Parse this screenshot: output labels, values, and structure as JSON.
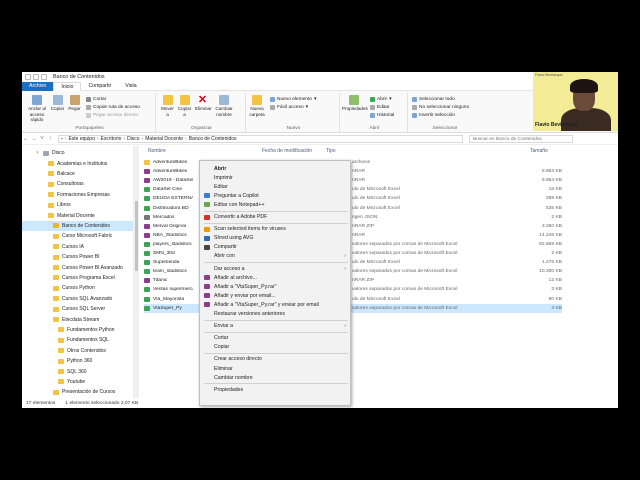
{
  "window": {
    "title": "Banco de Contenidos",
    "tabs": [
      "Archivo",
      "Inicio",
      "Compartir",
      "Vista"
    ]
  },
  "ribbon": {
    "portapapeles": {
      "label": "Portapapeles",
      "anclar": "Anclar al acceso rápido",
      "copiar": "Copiar",
      "pegar": "Pegar",
      "cortar": "Cortar",
      "copiar_ruta": "Copiar ruta de acceso",
      "pegar_acceso": "Pegar acceso directo"
    },
    "organizar": {
      "label": "Organizar",
      "mover": "Mover a",
      "copiar": "Copiar a",
      "eliminar": "Eliminar",
      "cambiar": "Cambiar nombre"
    },
    "nuevo": {
      "label": "Nuevo",
      "nueva_carpeta": "Nueva carpeta",
      "nuevo_elemento": "Nuevo elemento",
      "facil_acceso": "Fácil acceso"
    },
    "abrir": {
      "label": "Abrir",
      "propiedades": "Propiedades",
      "abrir": "Abrir",
      "editar": "Editar",
      "historial": "Historial"
    },
    "seleccionar": {
      "label": "Seleccionar",
      "todo": "Seleccionar todo",
      "ninguno": "No seleccionar ninguno",
      "invertir": "Invertir selección"
    }
  },
  "address": {
    "crumbs": [
      "Este equipo",
      "Escritorio",
      "Disco",
      "Material Docente",
      "Banco de Contenidos"
    ],
    "search_placeholder": "Buscar en Banco de Contenidos"
  },
  "columns": {
    "name": "Nombre",
    "date": "Fecha de modificación",
    "type": "Tipo",
    "size": "Tamaño"
  },
  "nav": [
    {
      "label": "Disco",
      "indent": 0
    },
    {
      "label": "Academias e Institutos",
      "indent": 1
    },
    {
      "label": "Balcace",
      "indent": 1
    },
    {
      "label": "Consultoras",
      "indent": 1
    },
    {
      "label": "Formaciones Empresas",
      "indent": 1
    },
    {
      "label": "Libros",
      "indent": 1
    },
    {
      "label": "Material Docente",
      "indent": 1
    },
    {
      "label": "Banco de Contenidos",
      "indent": 2,
      "selected": true
    },
    {
      "label": "Curso Microsoft Fabric",
      "indent": 2
    },
    {
      "label": "Cursos IA",
      "indent": 2
    },
    {
      "label": "Cursos Power BI",
      "indent": 2
    },
    {
      "label": "Cursos Power BI Avanzado",
      "indent": 2
    },
    {
      "label": "Cursos Programa Excel",
      "indent": 2
    },
    {
      "label": "Cursos Python",
      "indent": 2
    },
    {
      "label": "Cursos SQL Avanzado",
      "indent": 2
    },
    {
      "label": "Cursos SQL Server",
      "indent": 2
    },
    {
      "label": "Etecdata Stream",
      "indent": 2
    },
    {
      "label": "Fundamentos Python",
      "indent": 3
    },
    {
      "label": "Fundamentos SQL",
      "indent": 3
    },
    {
      "label": "Otros Contenidos",
      "indent": 3
    },
    {
      "label": "Python 360",
      "indent": 3
    },
    {
      "label": "SQL 360",
      "indent": 3
    },
    {
      "label": "Youtube",
      "indent": 3
    },
    {
      "label": "Presentación de Cursos",
      "indent": 2
    }
  ],
  "files": [
    {
      "name": "AdventureBikes",
      "type": "archivos",
      "size": ""
    },
    {
      "name": "AdventureBikes",
      "type": "nRAR",
      "size": "9.853 KB"
    },
    {
      "name": "AW2019 - DataSet",
      "type": "nRAR",
      "size": "9.854 KB"
    },
    {
      "name": "DataSet Cine",
      "type": "ulo de Microsoft Excel",
      "size": "18 KB"
    },
    {
      "name": "DEUDA EXTERNA",
      "type": "ulo de Microsoft Excel",
      "size": "289 KB"
    },
    {
      "name": "Distribuidora BD",
      "type": "ulo de Microsoft Excel",
      "size": "535 KB"
    },
    {
      "name": "Mercados",
      "type": "rigen JSON",
      "size": "2 KB"
    },
    {
      "name": "Merval Original",
      "type": "nRAR ZIP",
      "size": "3.250 KB"
    },
    {
      "name": "NBA_Stadistics",
      "type": "nRAR",
      "size": "14.246 KB"
    },
    {
      "name": "players_stadistics",
      "type": "valores separados por comas de Microsoft Excel",
      "size": "82.669 KB"
    },
    {
      "name": "SMN_30d",
      "type": "valores separados por comas de Microsoft Excel",
      "size": "2 KB"
    },
    {
      "name": "Supertienda",
      "type": "ulo de Microsoft Excel",
      "size": "1.276 KB"
    },
    {
      "name": "team_stadistics",
      "type": "valores separados por comas de Microsoft Excel",
      "size": "10.300 KB"
    },
    {
      "name": "Titanic",
      "type": "nRAR ZIP",
      "size": "12 KB"
    },
    {
      "name": "Ventas supermercado",
      "type": "valores separados por comas de Microsoft Excel",
      "size": "3 KB"
    },
    {
      "name": "Vta_Mayorista",
      "type": "ulo de Microsoft Excel",
      "size": "80 KB"
    },
    {
      "name": "VtaSuper_Py",
      "type": "valores separados por comas de Microsoft Excel",
      "size": "3 KB",
      "selected": true
    }
  ],
  "context_menu": [
    {
      "label": "Abrir",
      "bold": true
    },
    {
      "label": "Imprimir"
    },
    {
      "label": "Editar"
    },
    {
      "label": "Preguntar a Copilot",
      "icon": "#3b7bd4"
    },
    {
      "label": "Editar con Notepad++",
      "icon": "#6aa84f"
    },
    {
      "sep": true
    },
    {
      "label": "Convertir a Adobe PDF",
      "icon": "#d93025"
    },
    {
      "sep": true
    },
    {
      "label": "Scan selected items for viruses",
      "icon": "#f29900"
    },
    {
      "label": "Shred using AVG",
      "icon": "#2c6bb5"
    },
    {
      "label": "Compartir",
      "icon": "#444444"
    },
    {
      "label": "Abrir con",
      "submenu": true
    },
    {
      "sep": true
    },
    {
      "label": "Dar acceso a",
      "submenu": true
    },
    {
      "label": "Añadir al archivo...",
      "icon": "#8e3b8e"
    },
    {
      "label": "Añadir a \"VtaSuper_Py.rar\"",
      "icon": "#8e3b8e"
    },
    {
      "label": "Añadir y enviar por email...",
      "icon": "#8e3b8e"
    },
    {
      "label": "Añadir a \"VtaSuper_Py.rar\" y enviar por email",
      "icon": "#8e3b8e"
    },
    {
      "label": "Restaurar versiones anteriores"
    },
    {
      "sep": true
    },
    {
      "label": "Enviar a",
      "submenu": true
    },
    {
      "sep": true
    },
    {
      "label": "Cortar"
    },
    {
      "label": "Copiar"
    },
    {
      "sep": true
    },
    {
      "label": "Crear acceso directo"
    },
    {
      "label": "Eliminar"
    },
    {
      "label": "Cambiar nombre"
    },
    {
      "sep": true
    },
    {
      "label": "Propiedades"
    }
  ],
  "status": {
    "count": "17 elementos",
    "selection": "1 elemento seleccionado  2,07 KB"
  },
  "webcam": {
    "name": "Flavio Bevilacqua",
    "caption": "Flavio Bevilacqua"
  },
  "colors": {
    "file_tab": "#1b6ec2",
    "selection": "#cce8ff",
    "folder": "#f3c342",
    "webcam_bg": "#f4eb96"
  }
}
